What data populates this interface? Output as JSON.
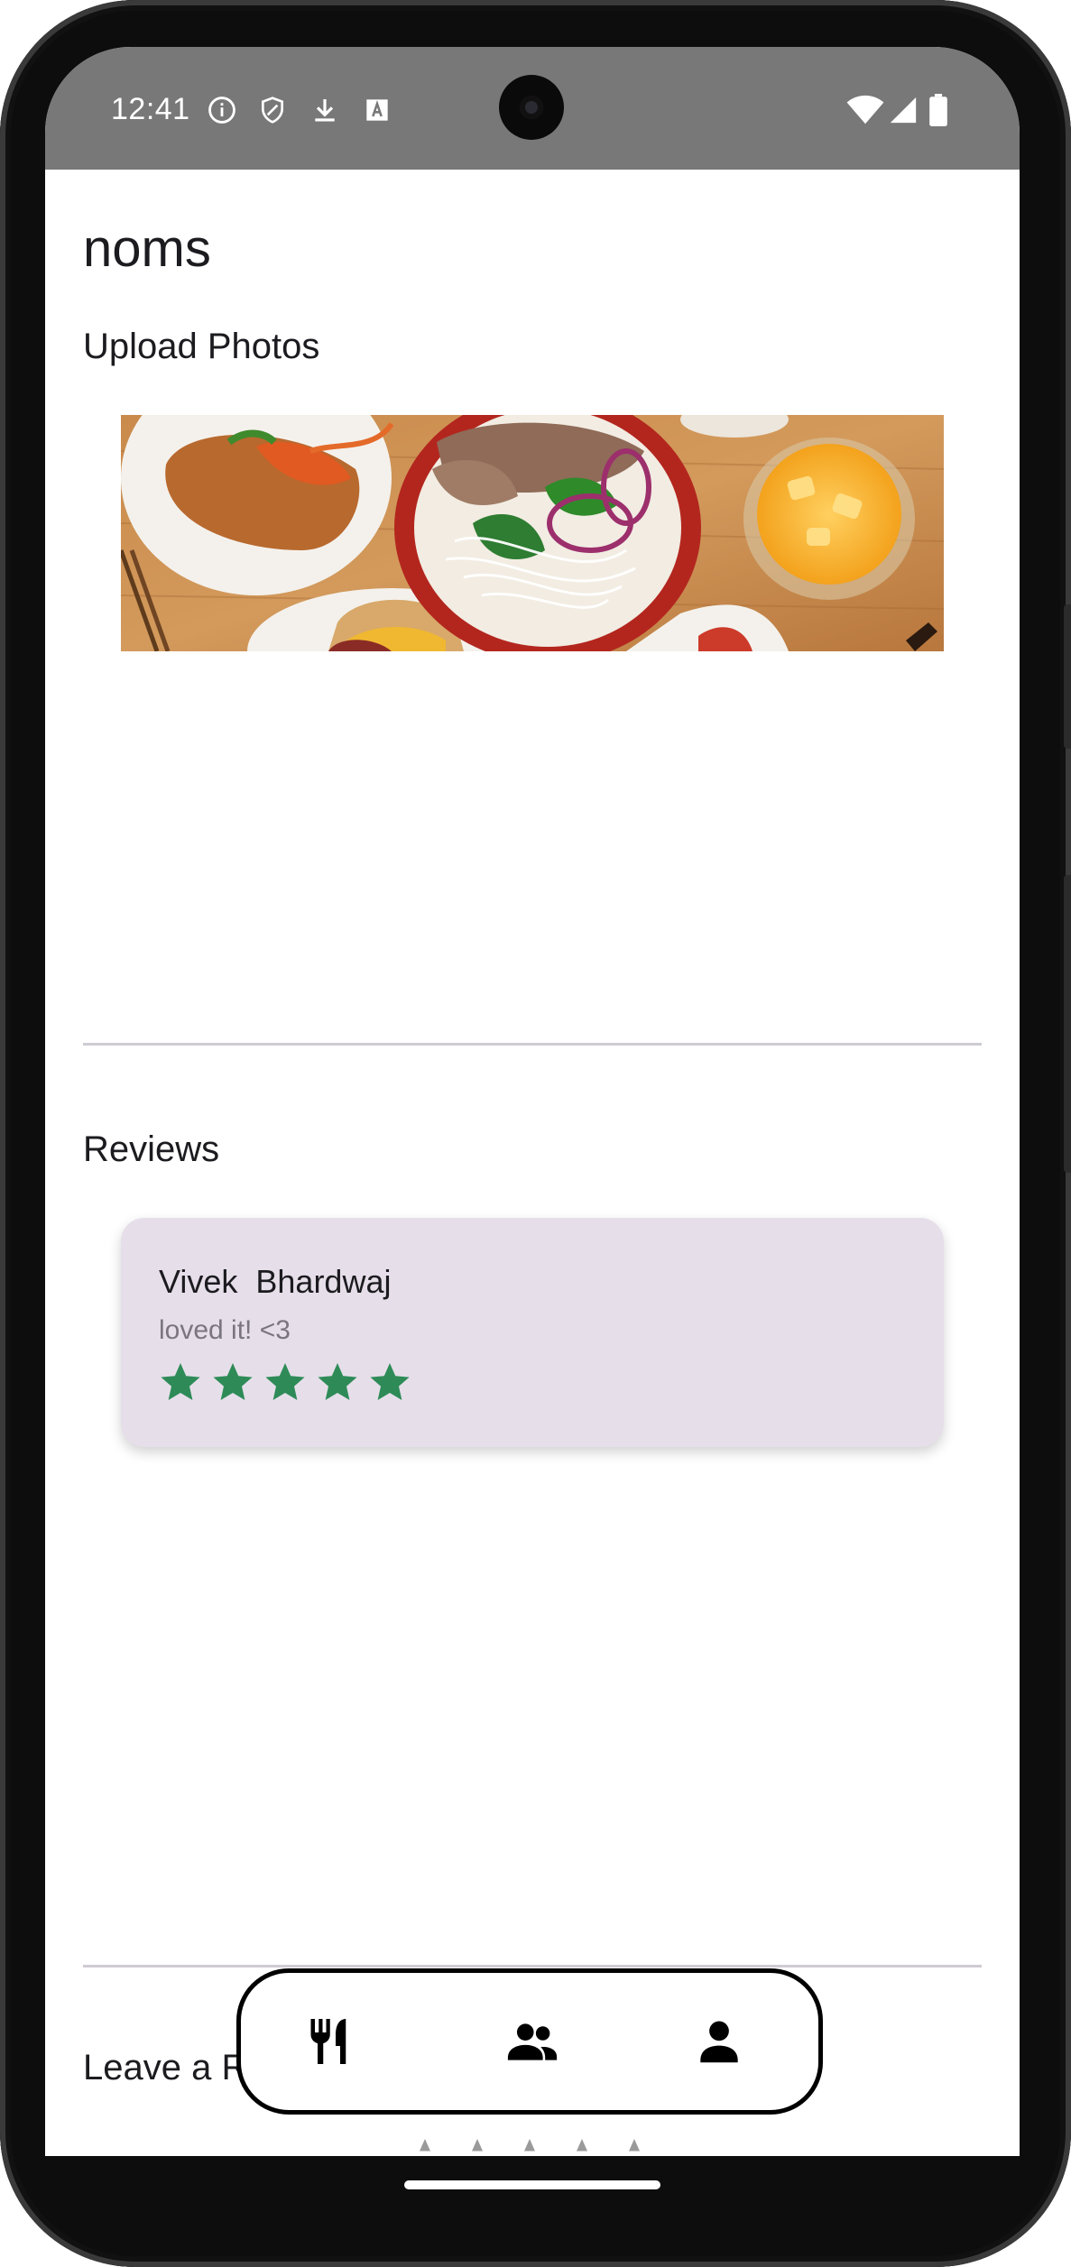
{
  "status_bar": {
    "time": "12:41",
    "left_icons": [
      "info-icon",
      "shield-icon",
      "download-icon",
      "text-icon"
    ],
    "right_icons": [
      "wifi-icon",
      "signal-icon",
      "battery-icon"
    ]
  },
  "app": {
    "title": "noms"
  },
  "upload_photos": {
    "heading": "Upload Photos"
  },
  "reviews": {
    "heading": "Reviews",
    "items": [
      {
        "name": "Vivek  Bhardwaj",
        "text": "loved it! <3",
        "rating": 5
      }
    ]
  },
  "leave_review": {
    "heading_visible": "Leave a R",
    "stars_count": 5
  },
  "bottom_nav": {
    "items": [
      "restaurant-icon",
      "group-icon",
      "person-icon"
    ]
  },
  "colors": {
    "status_bar": "#787878",
    "card_bg": "#e6dfea",
    "star_green": "#2e8b57",
    "divider": "#cfcbd3"
  }
}
